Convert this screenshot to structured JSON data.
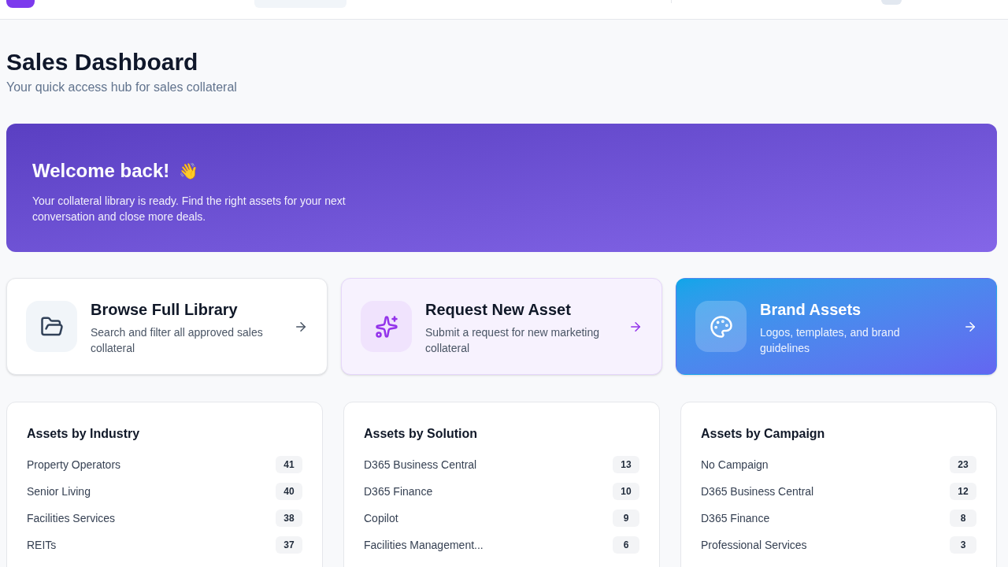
{
  "page": {
    "title": "Sales Dashboard",
    "subtitle": "Your quick access hub for sales collateral"
  },
  "banner": {
    "title": "Welcome back!",
    "emoji": "👋",
    "text": "Your collateral library is ready. Find the right assets for your next conversation and close more deals."
  },
  "actions": [
    {
      "kind": "library",
      "title": "Browse Full Library",
      "text": "Search and filter all approved sales collateral"
    },
    {
      "kind": "request",
      "title": "Request New Asset",
      "text": "Submit a request for new marketing collateral"
    },
    {
      "kind": "brand",
      "title": "Brand Assets",
      "text": "Logos, templates, and brand guidelines"
    }
  ],
  "panels": [
    {
      "title": "Assets by Industry",
      "items": [
        {
          "label": "Property Operators",
          "count": "41"
        },
        {
          "label": "Senior Living",
          "count": "40"
        },
        {
          "label": "Facilities Services",
          "count": "38"
        },
        {
          "label": "REITs",
          "count": "37"
        }
      ]
    },
    {
      "title": "Assets by Solution",
      "items": [
        {
          "label": "D365 Business Central",
          "count": "13"
        },
        {
          "label": "D365 Finance",
          "count": "10"
        },
        {
          "label": "Copilot",
          "count": "9"
        },
        {
          "label": "Facilities Management...",
          "count": "6"
        }
      ]
    },
    {
      "title": "Assets by Campaign",
      "items": [
        {
          "label": "No Campaign",
          "count": "23"
        },
        {
          "label": "D365 Business Central",
          "count": "12"
        },
        {
          "label": "D365 Finance",
          "count": "8"
        },
        {
          "label": "Professional Services",
          "count": "3"
        }
      ]
    }
  ]
}
